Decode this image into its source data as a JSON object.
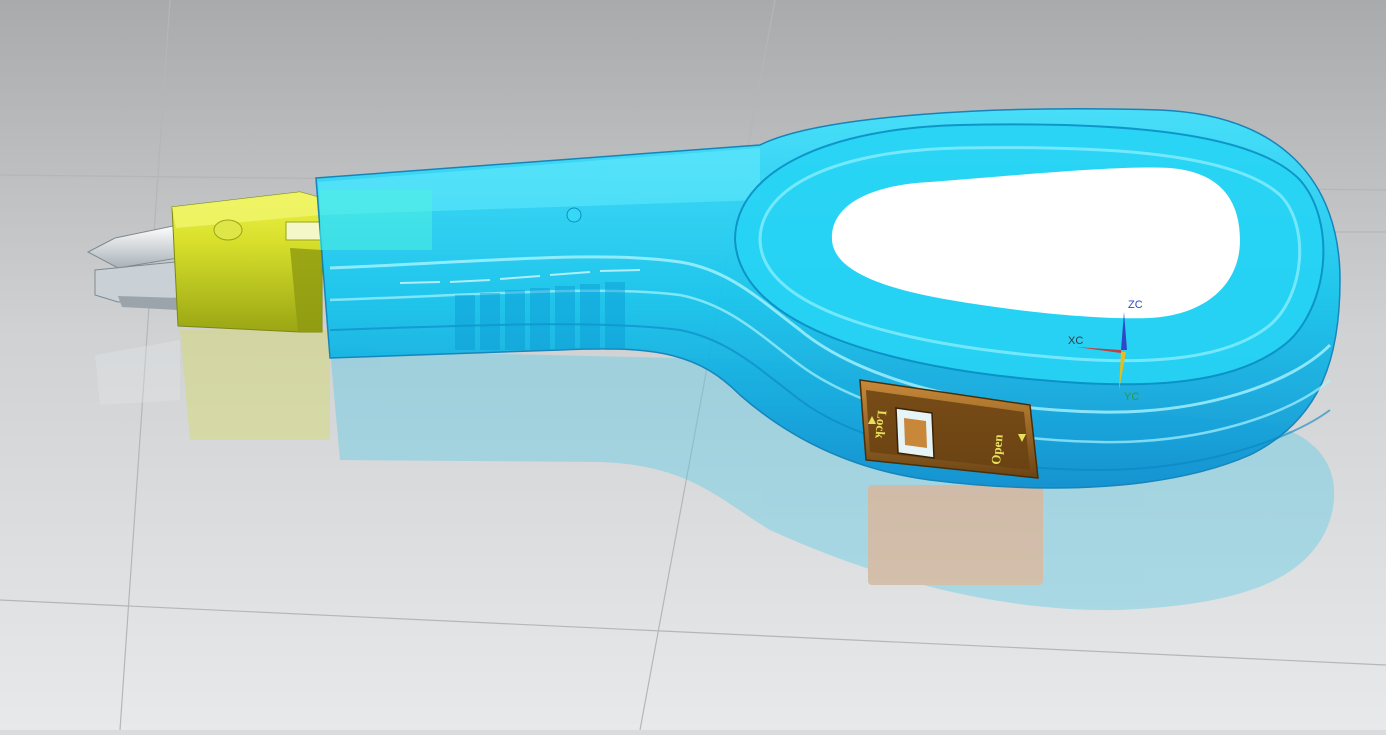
{
  "viewport": {
    "background_top": "#a8aaac",
    "background_bottom": "#e8e9ea",
    "grid_color": "#b4b6b8"
  },
  "model": {
    "body_color": "#10c8f0",
    "body_dark": "#0a8fc4",
    "head_color": "#b9c61a",
    "head_top_color": "#e6ee3a",
    "blade_color": "#e4e8ea",
    "slider_color": "#8a5a1e",
    "slider_labels": {
      "lock": "Lock",
      "open": "Open"
    }
  },
  "triad": {
    "x_label": "XC",
    "y_label": "YC",
    "z_label": "ZC",
    "x_color": "#c04040",
    "y_color": "#2f9a3a",
    "z_color": "#2e49c8"
  }
}
